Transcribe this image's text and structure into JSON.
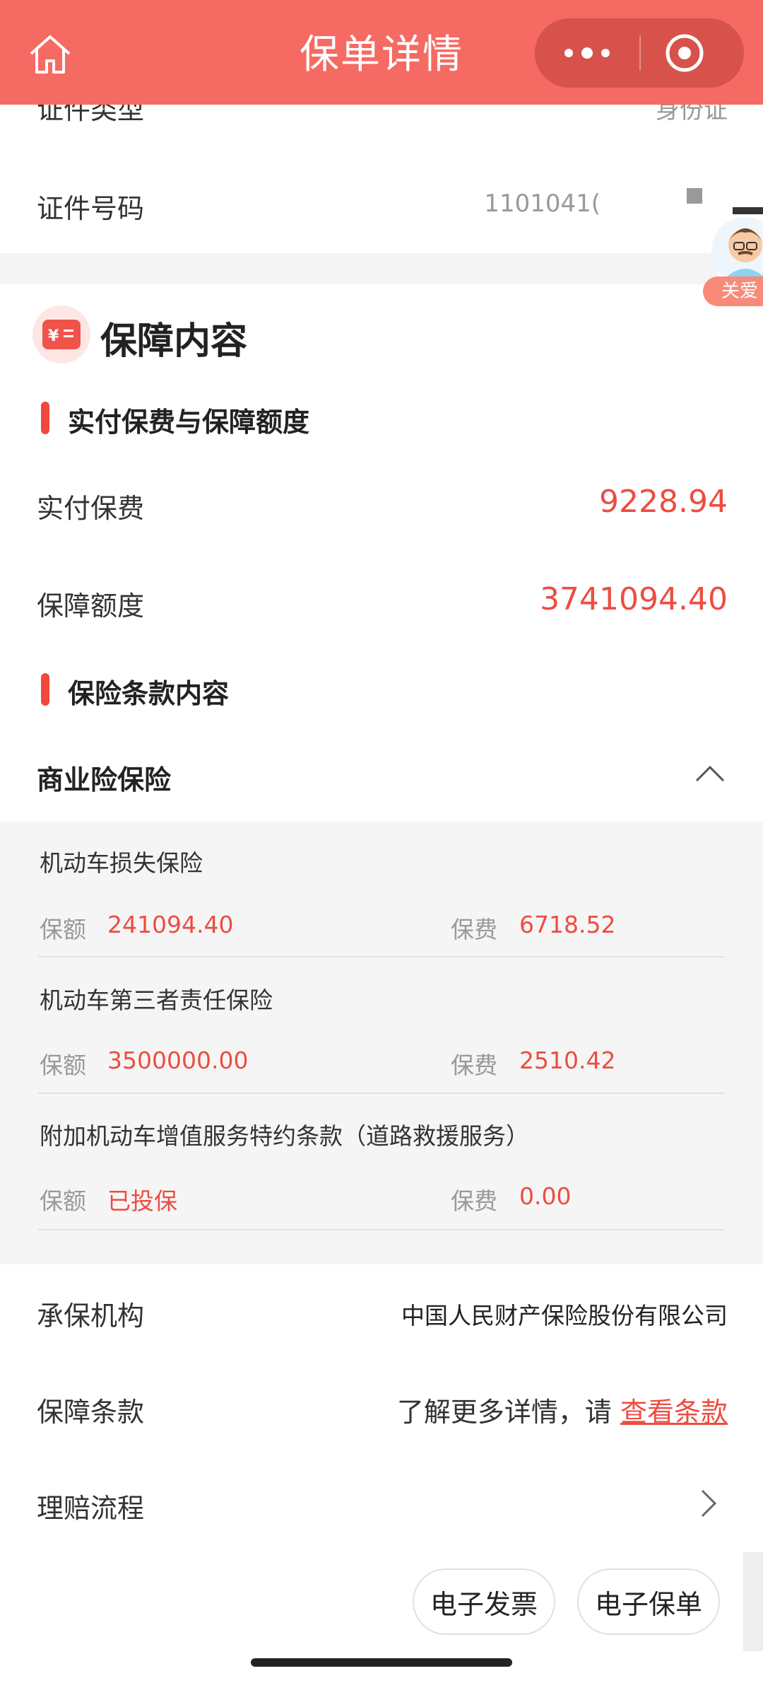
{
  "nav": {
    "title": "保单详情"
  },
  "info": {
    "cert_type_label": "证件类型",
    "cert_type_value": "身份证",
    "cert_no_label": "证件号码",
    "cert_no_value": "1101041("
  },
  "float_badge": "关爱",
  "coverage": {
    "title": "保障内容",
    "sub1_title": "实付保费与保障额度",
    "premium_label": "实付保费",
    "premium_value": "9228.94",
    "amount_label": "保障额度",
    "amount_value": "3741094.40",
    "sub2_title": "保险条款内容"
  },
  "commercial": {
    "title": "商业险保险",
    "items": [
      {
        "name": "机动车损失保险",
        "amount_label": "保额",
        "amount": "241094.40",
        "fee_label": "保费",
        "fee": "6718.52"
      },
      {
        "name": "机动车第三者责任保险",
        "amount_label": "保额",
        "amount": "3500000.00",
        "fee_label": "保费",
        "fee": "2510.42"
      },
      {
        "name": "附加机动车增值服务特约条款（道路救援服务）",
        "amount_label": "保额",
        "amount": "已投保",
        "fee_label": "保费",
        "fee": "0.00"
      }
    ]
  },
  "details": {
    "insurer_label": "承保机构",
    "insurer_value": "中国人民财产保险股份有限公司",
    "terms_label": "保障条款",
    "terms_prefix": "了解更多详情，请 ",
    "terms_link": "查看条款",
    "claims_label": "理赔流程"
  },
  "buttons": {
    "invoice": "电子发票",
    "policy": "电子保单"
  },
  "colors": {
    "nav_bg": "#f56a62",
    "accent_red": "#ec4d41"
  }
}
